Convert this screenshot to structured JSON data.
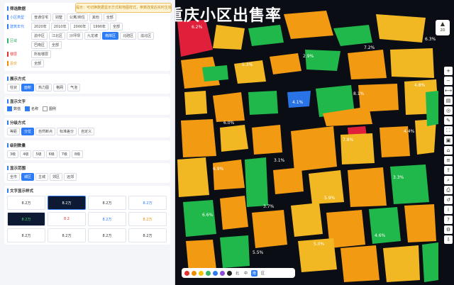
{
  "map_title": "重庆小区出售率",
  "notice": "提示：可切换数据显示方式和地图样式，参数改变后实时生效",
  "sections": {
    "filter": {
      "title": "筛选数据",
      "rows": [
        {
          "label": "小区类型",
          "bar": "#2d7cf6",
          "options": [
            "普通住宅",
            "别墅",
            "公寓/商住",
            "其他",
            "全部"
          ],
          "active": -1
        },
        {
          "label": "建筑年代",
          "bar": "#2d7cf6",
          "options": [
            "2020年",
            "2010年",
            "2000年",
            "1990年",
            "全部"
          ],
          "active": -1
        },
        {
          "label": "区域",
          "bar": "#35b36b",
          "options": [
            "渝中区",
            "江北区",
            "沙坪坝",
            "九龙坡",
            "南岸区",
            "北碚区",
            "渝北区",
            "巴南区",
            "全部"
          ],
          "active": 4
        },
        {
          "label": "楼层",
          "bar": "#e03030",
          "options": [
            "所有楼层"
          ],
          "active": -1
        },
        {
          "label": "总价",
          "bar": "#f08c00",
          "options": [
            "全部"
          ],
          "active": -1
        }
      ]
    },
    "display": {
      "title": "展示方式",
      "options": [
        "柱状",
        "面积",
        "热力图",
        "格网",
        "气泡"
      ],
      "active": 1
    },
    "labels": {
      "title": "显示文字",
      "items": [
        {
          "text": "数值",
          "on": true
        },
        {
          "text": "名称",
          "on": true
        },
        {
          "text": "图例",
          "on": false
        }
      ]
    },
    "cluster": {
      "title": "分级方式",
      "options": [
        "等距",
        "分位",
        "自然断点",
        "标准差分",
        "自定义"
      ],
      "active": 1
    },
    "level": {
      "title": "级别数量",
      "options": [
        "3级",
        "4级",
        "5级",
        "6级",
        "7级",
        "8级"
      ],
      "active": -1
    },
    "range": {
      "title": "显示范围",
      "options": [
        "全市",
        "城区",
        "主城",
        "郊区",
        "远郊"
      ],
      "active": 1
    },
    "style": {
      "title": "文字显示样式",
      "cards": [
        "8.2万",
        "8.2万",
        "8.2万",
        "8.2万",
        "8.2万",
        "8.2",
        "8.2万",
        "8.2万",
        "8.2万",
        "8.2万",
        "8.2万",
        "8.2万"
      ]
    }
  },
  "compass_label": "2D",
  "rightbar_icons": [
    "plus",
    "minus",
    "measure",
    "layer",
    "locate",
    "draw",
    "fullscreen",
    "camera",
    "home",
    "legend",
    "share",
    "zoom",
    "print",
    "reset",
    "info",
    "help",
    "settings",
    "export"
  ],
  "bottombar": {
    "colors": [
      "#e03030",
      "#f08c00",
      "#f5c400",
      "#35b36b",
      "#2d7cf6",
      "#8a4bd6",
      "#222222"
    ],
    "buttons": [
      "北",
      "中",
      "南",
      "区"
    ],
    "active": 2
  },
  "map_labels": [
    {
      "t": "6.2%"
    },
    {
      "t": "5.3%"
    },
    {
      "t": "4.1%"
    },
    {
      "t": "7.8%"
    },
    {
      "t": "3.3%"
    },
    {
      "t": "6.6%"
    },
    {
      "t": "5.5%"
    },
    {
      "t": "2.9%"
    },
    {
      "t": "8.1%"
    },
    {
      "t": "4.4%"
    },
    {
      "t": "6.9%"
    },
    {
      "t": "3.7%"
    },
    {
      "t": "5.0%"
    },
    {
      "t": "7.2%"
    },
    {
      "t": "4.8%"
    },
    {
      "t": "6.0%"
    },
    {
      "t": "3.1%"
    },
    {
      "t": "5.9%"
    },
    {
      "t": "4.6%"
    },
    {
      "t": "6.3%"
    }
  ],
  "colors": {
    "red": "#e0203a",
    "orange": "#f29a12",
    "yellow": "#f2b824",
    "green": "#20b84a",
    "blue": "#2a73e6",
    "road": "#1c2030"
  }
}
